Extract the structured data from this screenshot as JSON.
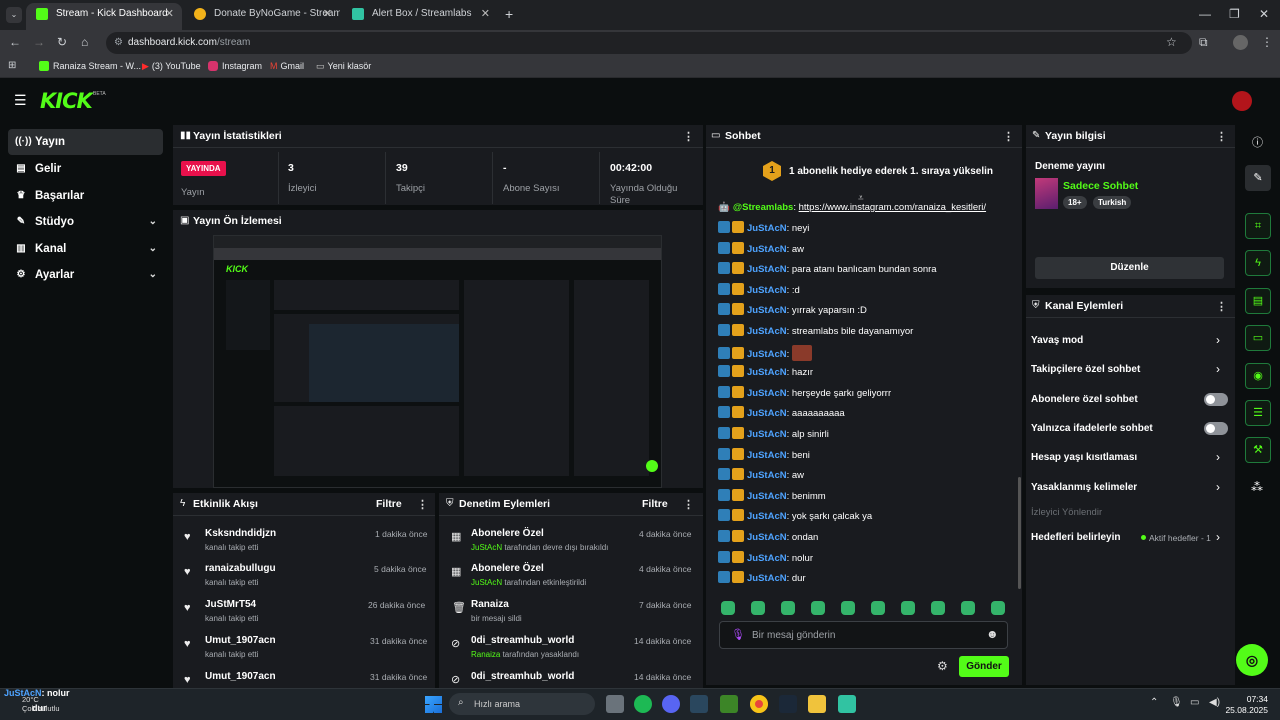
{
  "browser": {
    "tabs": [
      {
        "title": "Stream - Kick Dashboard",
        "active": true
      },
      {
        "title": "Donate ByNoGame - Streamer",
        "active": false
      },
      {
        "title": "Alert Box / Streamlabs",
        "active": false
      }
    ],
    "url_host": "dashboard.kick.com",
    "url_path": "/stream",
    "bookmarks": [
      "Ranaiza Stream - W...",
      "(3) YouTube",
      "Instagram",
      "Gmail",
      "Yeni klasör"
    ]
  },
  "kick": {
    "logo": "KICK",
    "beta": "BETA"
  },
  "nav": [
    {
      "label": "Yayın",
      "icon": "broadcast-icon",
      "active": true
    },
    {
      "label": "Gelir",
      "icon": "revenue-icon"
    },
    {
      "label": "Başarılar",
      "icon": "trophy-icon"
    },
    {
      "label": "Stüdyo",
      "icon": "studio-icon",
      "expandable": true
    },
    {
      "label": "Kanal",
      "icon": "channel-icon",
      "expandable": true
    },
    {
      "label": "Ayarlar",
      "icon": "gear-icon",
      "expandable": true
    }
  ],
  "stats": {
    "title": "Yayın İstatistikleri",
    "live_badge": "YAYINDA",
    "live_label": "Yayın",
    "viewers": {
      "value": "3",
      "label": "İzleyici"
    },
    "followers": {
      "value": "39",
      "label": "Takipçi"
    },
    "subs": {
      "value": "-",
      "label": "Abone Sayısı"
    },
    "duration": {
      "value": "00:42:00",
      "label": "Yayında Olduğu Süre"
    }
  },
  "preview": {
    "title": "Yayın Ön İzlemesi"
  },
  "activity": {
    "title": "Etkinlik Akışı",
    "filter": "Filtre",
    "items": [
      {
        "name": "Ksksndndidjzn",
        "sub": "kanalı takip etti",
        "time": "1 dakika önce"
      },
      {
        "name": "ranaizabullugu",
        "sub": "kanalı takip etti",
        "time": "5 dakika önce"
      },
      {
        "name": "JuStMrT54",
        "sub": "kanalı takip etti",
        "time": "26 dakika önce"
      },
      {
        "name": "Umut_1907acn",
        "sub": "kanalı takip etti",
        "time": "31 dakika önce"
      },
      {
        "name": "Umut_1907acn",
        "sub": "",
        "time": "31 dakika önce"
      }
    ]
  },
  "moderation": {
    "title": "Denetim Eylemleri",
    "filter": "Filtre",
    "items": [
      {
        "name": "Abonelere Özel",
        "actor": "JuStAcN",
        "sub": " tarafından devre dışı bırakıldı",
        "time": "4 dakika önce",
        "icon": "gift-icon"
      },
      {
        "name": "Abonelere Özel",
        "actor": "JuStAcN",
        "sub": " tarafından etkinleştirildi",
        "time": "4 dakika önce",
        "icon": "gift-icon"
      },
      {
        "name": "Ranaiza",
        "actor": "",
        "sub": "bir mesajı sildi",
        "time": "7 dakika önce",
        "icon": "trash-icon"
      },
      {
        "name": "0di_streamhub_world",
        "actor": "Ranaiza",
        "sub": " tarafından yasaklandı",
        "time": "14 dakika önce",
        "icon": "ban-icon"
      },
      {
        "name": "0di_streamhub_world",
        "actor": "",
        "sub": "",
        "time": "14 dakika önce",
        "icon": "ban-icon"
      }
    ]
  },
  "chat": {
    "title": "Sohbet",
    "pinned": "1 abonelik hediye ederek 1. sıraya yükselin",
    "pinned_rank": "1",
    "streamlabs_user": "@Streamlabs",
    "streamlabs_link": "https://www.instagram.com/ranaiza_kesitleri/",
    "username": "JuStAcN",
    "messages": [
      "neyi",
      "aw",
      "para atanı banlıcam bundan sonra",
      ":d",
      "yırrak yaparsın :D",
      "streamlabs bile dayanamıyor",
      "",
      "hazır",
      "herşeyde şarkı geliyorrr",
      "aaaaaaaaaa",
      "alp sinirli",
      "beni",
      "aw",
      "benimm",
      "yok şarkı çalcak ya",
      "ondan",
      "nolur",
      "dur"
    ],
    "input_placeholder": "Bir mesaj gönderin",
    "send": "Gönder"
  },
  "info": {
    "title": "Yayın bilgisi",
    "stream_title": "Deneme yayını",
    "category": "Sadece Sohbet",
    "tags": [
      "18+",
      "Turkish"
    ],
    "edit": "Düzenle"
  },
  "channel_actions": {
    "title": "Kanal Eylemleri",
    "items": [
      {
        "label": "Yavaş mod",
        "type": "chevron"
      },
      {
        "label": "Takipçilere özel sohbet",
        "type": "chevron"
      },
      {
        "label": "Abonelere özel sohbet",
        "type": "toggle"
      },
      {
        "label": "Yalnızca ifadelerle sohbet",
        "type": "toggle"
      },
      {
        "label": "Hesap yaşı kısıtlaması",
        "type": "chevron"
      },
      {
        "label": "Yasaklanmış kelimeler",
        "type": "chevron"
      }
    ],
    "raid_section": "İzleyici Yönlendir",
    "targets_label": "Hedefleri belirleyin",
    "targets_status": "Aktif hedefler - 1"
  },
  "taskbar": {
    "search": "Hızlı arama",
    "weather": "20°C",
    "weather_desc": "Çok bulutlu",
    "overlay_user": "JuStAcN",
    "overlay_msg1": "nolur",
    "overlay_msg2": "dur",
    "time": "07:34",
    "date": "25.08.2025"
  },
  "colors": {
    "accent": "#53fc18",
    "live": "#e9114c",
    "link": "#4ea3ff",
    "panel": "#191b1f"
  }
}
